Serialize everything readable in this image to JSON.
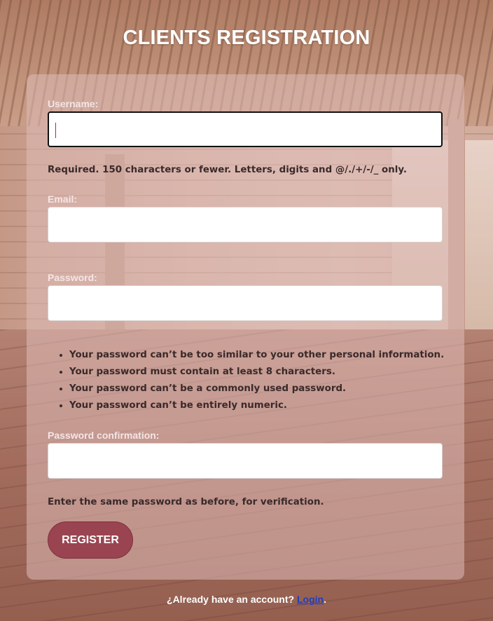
{
  "page": {
    "title": "CLIENTS REGISTRATION"
  },
  "form": {
    "username": {
      "label": "Username:",
      "value": "",
      "help": "Required. 150 characters or fewer. Letters, digits and @/./+/-/_ only."
    },
    "email": {
      "label": "Email:",
      "value": ""
    },
    "password": {
      "label": "Password:",
      "value": ""
    },
    "password_rules": [
      "Your password can’t be too similar to your other personal information.",
      "Your password must contain at least 8 characters.",
      "Your password can’t be a commonly used password.",
      "Your password can’t be entirely numeric."
    ],
    "password_confirmation": {
      "label": "Password confirmation:",
      "value": "",
      "help": "Enter the same password as before, for verification."
    },
    "register_label": "REGISTER"
  },
  "footer": {
    "text": "¿Already have an account?",
    "link_label": "Login",
    "suffix": "."
  },
  "colors": {
    "button": "#9b4451",
    "link": "#1f3fbf",
    "card": "#debcb8"
  }
}
